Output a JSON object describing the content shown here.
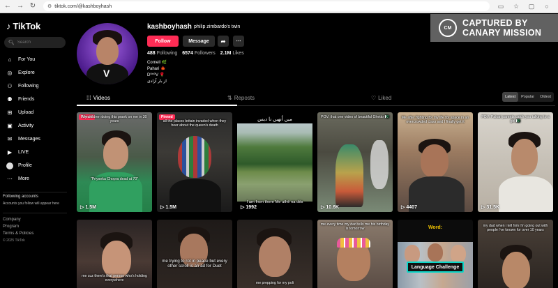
{
  "browser": {
    "url": "tiktok.com/@kashboyhash",
    "back_icon": "arrow-left",
    "forward_icon": "arrow-right",
    "reload_icon": "reload"
  },
  "sidebar": {
    "logo": "TikTok",
    "search_placeholder": "Search",
    "items": [
      {
        "label": "For You",
        "icon": "home-icon"
      },
      {
        "label": "Explore",
        "icon": "compass-icon"
      },
      {
        "label": "Following",
        "icon": "following-icon"
      },
      {
        "label": "Friends",
        "icon": "friends-icon"
      },
      {
        "label": "Upload",
        "icon": "upload-icon"
      },
      {
        "label": "Activity",
        "icon": "activity-icon"
      },
      {
        "label": "Messages",
        "icon": "messages-icon"
      },
      {
        "label": "LIVE",
        "icon": "live-icon"
      },
      {
        "label": "Profile",
        "icon": "profile-icon"
      },
      {
        "label": "More",
        "icon": "more-icon"
      }
    ],
    "following_accounts_title": "Following accounts",
    "following_accounts_sub": "Accounts you follow will appear here",
    "footer": [
      "Company",
      "Program",
      "Terms & Policies"
    ],
    "copyright": "© 2025 TikTok"
  },
  "profile": {
    "username": "kashboyhash",
    "nickname": "philip zimbardo's twin",
    "follow_label": "Follow",
    "message_label": "Message",
    "following_count": "488",
    "following_label": "Following",
    "followers_count": "6574",
    "followers_label": "Followers",
    "likes_count": "2.1M",
    "likes_label": "Likes",
    "bio": [
      "Cornell 🌿",
      "Pahari 🍁",
      "D⁰^⁰V 🌹",
      "از بار آزادی"
    ]
  },
  "watermark": {
    "line1": "CAPTURED BY",
    "line2": "CANARY MISSION",
    "seal": "CM"
  },
  "tabs": {
    "videos": "Videos",
    "reposts": "Reposts",
    "liked": "Liked",
    "sort": [
      "Latest",
      "Popular",
      "Oldest"
    ],
    "active_sort": "Latest"
  },
  "videos": [
    {
      "pinned": "Pinned",
      "caption_top": "My children doing this prank on me in 30 years",
      "caption_mid": "\"Priyanka Chopra dead at 70\"",
      "views": "1.5M"
    },
    {
      "pinned": "Pinned",
      "caption_top": "all the places britain invaded when they heer about the queen's death",
      "views": "1.5M"
    },
    {
      "caption_top": "میں اُنھیں نا دیس",
      "caption_mid": "I am from there Me uthè na dés",
      "views": "1992"
    },
    {
      "caption_top": "POV: that one video of beautiful Ghetto 🇵🇰",
      "views": "10.6K"
    },
    {
      "caption_top": "Me after fighting for my life for space in an overcrowded class and I finally get it",
      "views": "4407"
    },
    {
      "caption_top": "POV: Pahari parents catch you talking to a girl 🇵🇰",
      "views": "31.5K"
    },
    {
      "caption_bottom": "me cuz there's that person who's holding everywhere"
    },
    {
      "caption_mid": "me trying to rot in peace but every other scroll is an ad for Duet"
    },
    {
      "caption_bottom": "me prepping for my poli"
    },
    {
      "caption_top": "me every time my dad tells me his birthday is tomorrow"
    },
    {
      "word": "Word:",
      "badge": "Language Challenge"
    },
    {
      "caption_top": "my dad when i tell him i'm going out with people i've known for over 10 years"
    }
  ]
}
